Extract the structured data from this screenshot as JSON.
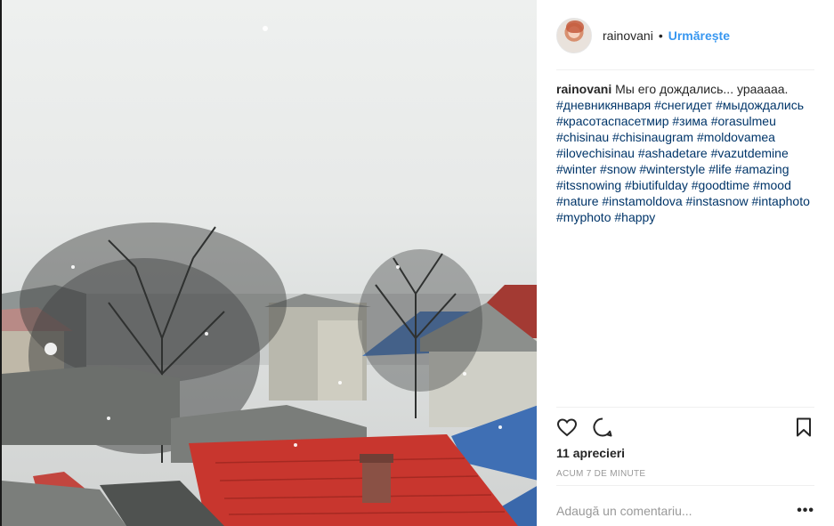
{
  "post": {
    "image_alt": "Snowy rooftops with red and blue roofs and bare trees",
    "author": {
      "username": "rainovani",
      "separator": "•",
      "follow_label": "Urmărește"
    },
    "caption": {
      "author": "rainovani",
      "text": "Мы его дождались... урааааа.",
      "hashtags": [
        "#дневникянваря",
        "#снегидет",
        "#мыдождались",
        "#красотаспасетмир",
        "#зима",
        "#orasulmeu",
        "#chisinau",
        "#chisinaugram",
        "#moldovamea",
        "#ilovechisinau",
        "#ashadetare",
        "#vazutdemine",
        "#winter",
        "#snow",
        "#winterstyle",
        "#life",
        "#amazing",
        "#itssnowing",
        "#biutifulday",
        "#goodtime",
        "#mood",
        "#nature",
        "#instamoldova",
        "#instasnow",
        "#intaphoto",
        "#myphoto",
        "#happy"
      ]
    },
    "likes_label": "11 aprecieri",
    "time_label": "ACUM 7 DE MINUTE",
    "comment_placeholder": "Adaugă un comentariu...",
    "more_label": "•••",
    "icons": [
      "heart-icon",
      "comment-icon",
      "bookmark-icon",
      "more-options-icon"
    ]
  }
}
